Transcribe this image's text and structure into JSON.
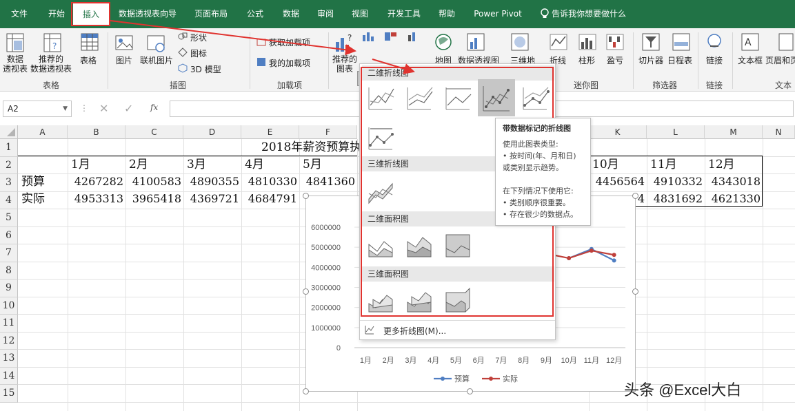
{
  "ribbon_tabs": [
    "文件",
    "开始",
    "插入",
    "数据透视表向导",
    "页面布局",
    "公式",
    "数据",
    "审阅",
    "视图",
    "开发工具",
    "帮助",
    "Power Pivot",
    "告诉我你想要做什么"
  ],
  "ribbon": {
    "tables": {
      "pivot": "数据\n透视表",
      "recommended_pivot": "推荐的\n数据透视表",
      "table": "表格",
      "group": "表格"
    },
    "illustrations": {
      "picture": "图片",
      "online_picture": "联机图片",
      "shapes": "形状",
      "icons": "图标",
      "model3d": "3D 模型",
      "group": "插图"
    },
    "addins": {
      "get": "获取加载项",
      "my": "我的加载项",
      "group": "加载项"
    },
    "charts": {
      "recommended": "推荐的\n图表",
      "maps": "地图",
      "pivot_chart": "数据透视图",
      "chart3d": "三维地"
    },
    "sparklines": {
      "line": "折线",
      "column": "柱形",
      "winloss": "盈亏",
      "group": "迷你图"
    },
    "filters": {
      "slicer": "切片器",
      "timeline": "日程表",
      "group": "筛选器"
    },
    "links": {
      "link": "链接",
      "group": "链接"
    },
    "text": {
      "textbox": "文本框",
      "header_footer": "页眉和页",
      "group": "文本"
    }
  },
  "formula_bar": {
    "name_box": "A2",
    "fx": "fx",
    "value": ""
  },
  "columns": [
    "A",
    "B",
    "C",
    "D",
    "E",
    "F",
    "K",
    "L",
    "M",
    "N"
  ],
  "rows": [
    "1",
    "2",
    "3",
    "4",
    "5",
    "6",
    "7",
    "8",
    "9",
    "10",
    "11",
    "12",
    "13",
    "14",
    "15"
  ],
  "sheet": {
    "title": "2018年薪资预算执",
    "months": [
      "1月",
      "2月",
      "3月",
      "4月",
      "5月"
    ],
    "months_right": [
      "10月",
      "11月",
      "12月"
    ],
    "budget_label": "预算",
    "actual_label": "实际",
    "budget_left": [
      "4267282",
      "4100583",
      "4890355",
      "4810330",
      "4841360"
    ],
    "actual_left": [
      "4953313",
      "3965418",
      "4369721",
      "4684791"
    ],
    "budget_right": [
      "4456564",
      "4910332",
      "4343018"
    ],
    "actual_right": [
      "4",
      "4831692",
      "4621330"
    ]
  },
  "dropdown": {
    "sec_2d_line": "二维折线图",
    "sec_3d_line": "三维折线图",
    "sec_2d_area": "二维面积图",
    "sec_3d_area": "三维面积图",
    "more": "更多折线图(M)..."
  },
  "tooltip": {
    "title": "带数据标记的折线图",
    "line1": "使用此图表类型:",
    "line2": "• 按时间(年、月和日)",
    "line3": "或类别显示趋势。",
    "line4": "在下列情况下使用它:",
    "line5": "• 类别顺序很重要。",
    "line6": "• 存在很少的数据点。"
  },
  "colors": {
    "excel_green": "#217346",
    "highlight_red": "#e0332f",
    "series_budget": "#4f7ec2",
    "series_actual": "#c0403a"
  },
  "chart_data": {
    "type": "line",
    "categories": [
      "1月",
      "2月",
      "3月",
      "4月",
      "5月",
      "6月",
      "7月",
      "8月",
      "9月",
      "10月",
      "11月",
      "12月"
    ],
    "y_ticks": [
      "6000000",
      "5000000",
      "4000000",
      "3000000",
      "2000000",
      "1000000",
      "0"
    ],
    "ylim": [
      0,
      6000000
    ],
    "series": [
      {
        "name": "预算",
        "values": [
          4267282,
          null,
          null,
          null,
          null,
          null,
          null,
          null,
          null,
          4456564,
          4910332,
          4343018
        ]
      },
      {
        "name": "实际",
        "values": [
          4953313,
          null,
          null,
          null,
          null,
          null,
          null,
          null,
          4684791,
          4456564,
          4831692,
          4621330
        ]
      }
    ],
    "legend": "bottom"
  },
  "watermark": "头条 @Excel大白"
}
